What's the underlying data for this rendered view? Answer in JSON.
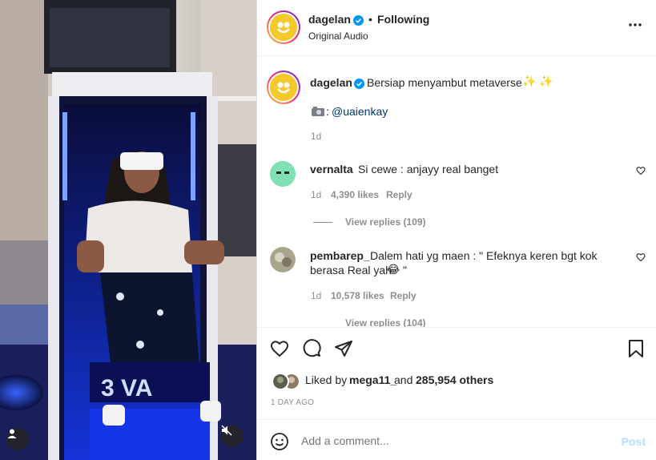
{
  "post": {
    "username": "dagelan",
    "follow_status": "Following",
    "separator": "•",
    "audio": "Original Audio"
  },
  "caption": {
    "username": "dagelan",
    "text": "Bersiap menyambut metaverse",
    "emoji": "✨ ✨",
    "credit_icon": "camera-icon",
    "credit_prefix": ":",
    "credit_handle": "@uaienkay",
    "time": "1d"
  },
  "comments": [
    {
      "username": "vernalta",
      "text": "Si cewe : anjayy real banget",
      "time": "1d",
      "likes": "4,390 likes",
      "reply": "Reply",
      "view_replies": "View replies (109)"
    },
    {
      "username": "pembarep_",
      "text_line1": "Dalem hati yg maen : \" Efeknya keren bgt kok",
      "text_line2": "berasa Real yah",
      "emoji": "😂",
      "text_end": "\"",
      "time": "1d",
      "likes": "10,578 likes",
      "reply": "Reply",
      "view_replies": "View replies (104)"
    }
  ],
  "liked_by": {
    "prefix": "Liked by",
    "user": "mega11_",
    "middle": "and",
    "count": "285,954 others"
  },
  "timestamp": "1 DAY AGO",
  "add_comment": {
    "placeholder": "Add a comment...",
    "post_label": "Post"
  },
  "video_overlay_text": "3 VA",
  "colors": {
    "link": "#00376b",
    "blue": "#0095f6",
    "post_disabled": "#b2dffc",
    "muted": "#8e8e8e"
  }
}
